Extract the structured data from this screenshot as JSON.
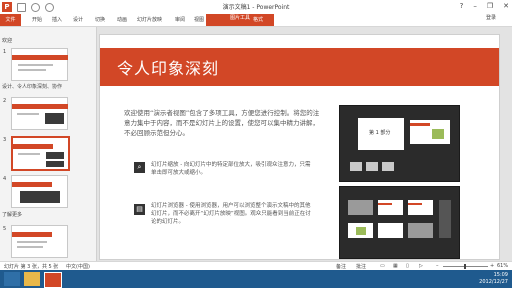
{
  "titlebar": {
    "title": "演示文稿1 - PowerPoint",
    "help": "?",
    "minimize": "–",
    "restore": "❐",
    "close": "✕",
    "app_icon": "P"
  },
  "ribbon": {
    "file": "文件",
    "tabs": [
      "开始",
      "插入",
      "设计",
      "切换",
      "动画",
      "幻灯片放映",
      "审阅",
      "视图"
    ],
    "tool_group": "图片工具",
    "format_tab": "格式",
    "account": "登录"
  },
  "thumbnails": {
    "sections": [
      "欢迎",
      "设计、令人印象深刻、协作",
      "了解更多"
    ],
    "slide_numbers": [
      "1",
      "2",
      "3",
      "4",
      "5"
    ]
  },
  "slide": {
    "title": "令人印象深刻",
    "intro": "欢迎使用“演示者视图”包含了多项工具，方便您进行控制。将您的注意力集中于内容，而不是幻灯片上的设置，使您可以集中精力讲解，不必回顾示范但分心。",
    "features": [
      {
        "icon": "magnifier-icon",
        "text": "幻灯片缩放 - 向幻灯片中的特定部位放大，吸引观众注意力，只需单击即可放大或缩小。"
      },
      {
        "icon": "slides-icon",
        "text": "幻灯片浏览器 - 使用浏览器，用户可以浏览整个演示文稿中的其他幻灯片，而不必离开“幻灯片放映”视图。观众只能看到当前正在讨论的幻灯片。"
      }
    ],
    "screenshot_caption": "第 1 部分"
  },
  "statusbar": {
    "slide_info": "幻灯片 第 3 张，共 5 张",
    "language": "中文(中国)",
    "notes": "备注",
    "comments": "批注",
    "zoom": "61%"
  },
  "taskbar": {
    "time": "15:09",
    "date": "2012/12/27"
  },
  "colors": {
    "accent": "#d24726",
    "taskbar": "#1f5a8e"
  }
}
